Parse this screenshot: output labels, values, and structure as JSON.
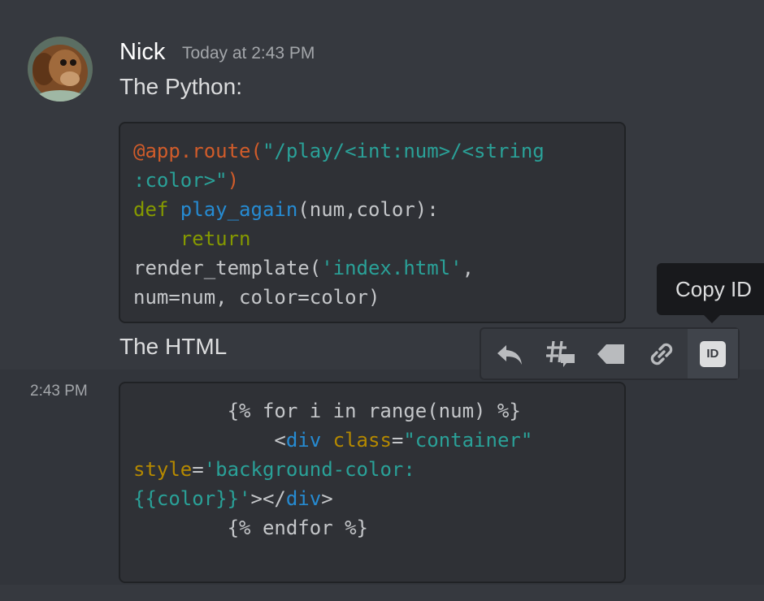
{
  "message1": {
    "author": "Nick",
    "timestamp": "Today at 2:43 PM",
    "text1": "The Python:",
    "code_lines": [
      [
        {
          "t": "@app.route(",
          "c": "deco"
        },
        {
          "t": "\"/play/<int:num>/<string",
          "c": "str"
        }
      ],
      [
        {
          "t": ":color>\"",
          "c": "str"
        },
        {
          "t": ")",
          "c": "deco"
        }
      ],
      [
        {
          "t": "def ",
          "c": "kw"
        },
        {
          "t": "play_again",
          "c": "fn"
        },
        {
          "t": "(num,color):",
          "c": "plain"
        }
      ],
      [
        {
          "t": "    return",
          "c": "kw"
        }
      ],
      [
        {
          "t": "render_template(",
          "c": "plain"
        },
        {
          "t": "'index.html'",
          "c": "str"
        },
        {
          "t": ",",
          "c": "plain"
        }
      ],
      [
        {
          "t": "num=num, color=color)",
          "c": "plain"
        }
      ]
    ],
    "text2": "The HTML"
  },
  "message2": {
    "side_time": "2:43 PM",
    "code_lines": [
      [
        {
          "t": "        {% for i in range(num) %}",
          "c": "plain"
        }
      ],
      [
        {
          "t": "            <",
          "c": "plain"
        },
        {
          "t": "div",
          "c": "tag"
        },
        {
          "t": " ",
          "c": "plain"
        },
        {
          "t": "class",
          "c": "attr"
        },
        {
          "t": "=",
          "c": "plain"
        },
        {
          "t": "\"container\"",
          "c": "str"
        }
      ],
      [
        {
          "t": "style",
          "c": "attr"
        },
        {
          "t": "=",
          "c": "plain"
        },
        {
          "t": "'background-color:",
          "c": "str"
        }
      ],
      [
        {
          "t": "{{color}}'",
          "c": "str"
        },
        {
          "t": "></",
          "c": "plain"
        },
        {
          "t": "div",
          "c": "tag"
        },
        {
          "t": ">",
          "c": "plain"
        }
      ],
      [
        {
          "t": "        {% endfor %}",
          "c": "plain"
        }
      ]
    ]
  },
  "toolbar": {
    "buttons": [
      {
        "name": "reply-icon"
      },
      {
        "name": "create-thread-icon"
      },
      {
        "name": "mark-unread-icon"
      },
      {
        "name": "copy-link-icon"
      },
      {
        "name": "copy-id-icon",
        "label": "ID"
      }
    ],
    "tooltip": "Copy ID"
  },
  "colors": {
    "background": "#36393f",
    "hover_background": "#32353b",
    "code_background": "#2f3136",
    "tooltip_background": "#18191c"
  }
}
